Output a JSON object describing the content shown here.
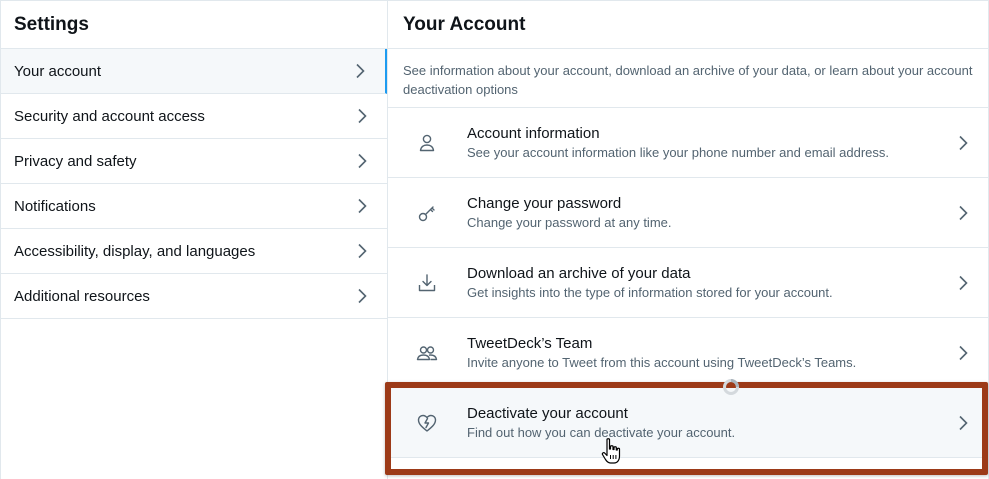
{
  "settings": {
    "title": "Settings",
    "items": [
      {
        "label": "Your account"
      },
      {
        "label": "Security and account access"
      },
      {
        "label": "Privacy and safety"
      },
      {
        "label": "Notifications"
      },
      {
        "label": "Accessibility, display, and languages"
      },
      {
        "label": "Additional resources"
      }
    ]
  },
  "account": {
    "title": "Your Account",
    "description": "See information about your account, download an archive of your data, or learn about your account deactivation options",
    "rows": [
      {
        "title": "Account information",
        "subtitle": "See your account information like your phone number and email address.",
        "icon": "person-icon"
      },
      {
        "title": "Change your password",
        "subtitle": "Change your password at any time.",
        "icon": "key-icon"
      },
      {
        "title": "Download an archive of your data",
        "subtitle": "Get insights into the type of information stored for your account.",
        "icon": "download-icon"
      },
      {
        "title": "TweetDeck’s Team",
        "subtitle": "Invite anyone to Tweet from this account using TweetDeck’s Teams.",
        "icon": "team-icon"
      },
      {
        "title": "Deactivate your account",
        "subtitle": "Find out how you can deactivate your account.",
        "icon": "broken-heart-icon"
      }
    ]
  },
  "colors": {
    "accent": "#1d9bf0",
    "highlight_border": "#9c3a18",
    "muted_text": "#536471"
  }
}
